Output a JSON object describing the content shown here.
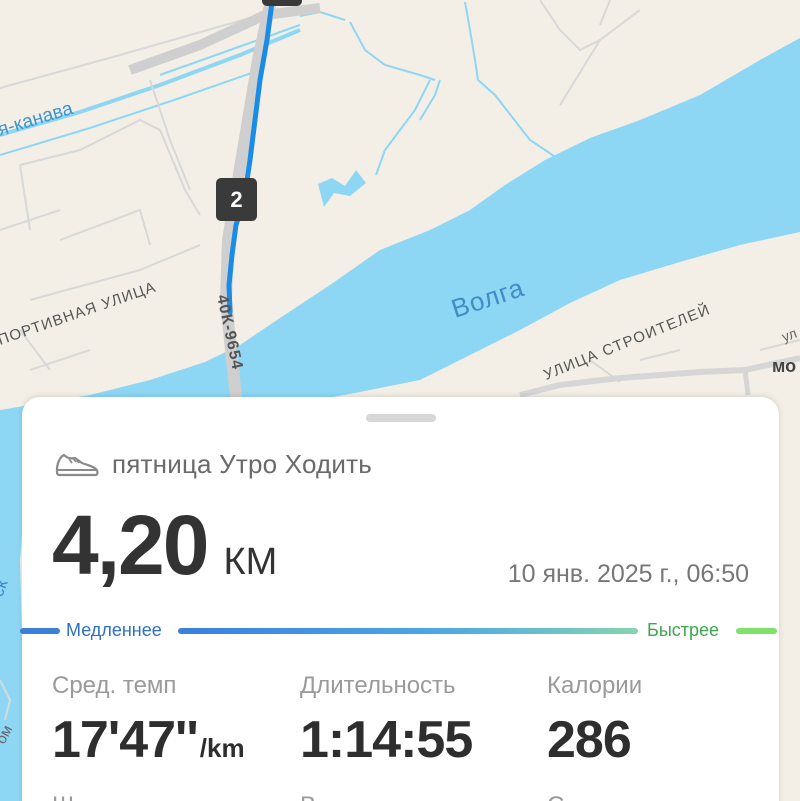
{
  "map": {
    "labels": {
      "canal": "я-канава",
      "road": "40К-9654",
      "river": "Волга",
      "street_left": "ПОРТИВНАЯ УЛИЦА",
      "street_right": "УЛИЦА СТРОИТЕЛЕЙ",
      "fragment_right": "мо",
      "fragment_right_top": "ул",
      "fragment_left": "ск",
      "fragment_left_bottom": "ом"
    },
    "marker_2": "2",
    "colors": {
      "land": "#f3efe6",
      "water": "#8dd7f5",
      "route": "#1a8ce6",
      "marker": "#3a3a3a"
    }
  },
  "card": {
    "activity_icon": "shoe-icon",
    "activity_title": "пятница Утро Ходить",
    "distance_value": "4,20",
    "distance_unit": "КМ",
    "datetime": "10 янв. 2025 г., 06:50",
    "pace_scale": {
      "slow": "Медленнее",
      "fast": "Быстрее"
    },
    "stats": [
      {
        "label": "Сред. темп",
        "value": "17'47''",
        "unit": "/km"
      },
      {
        "label": "Длительность",
        "value": "1:14:55"
      },
      {
        "label": "Калории",
        "value": "286"
      }
    ],
    "next_row": [
      "Ш",
      "В",
      "С"
    ]
  }
}
